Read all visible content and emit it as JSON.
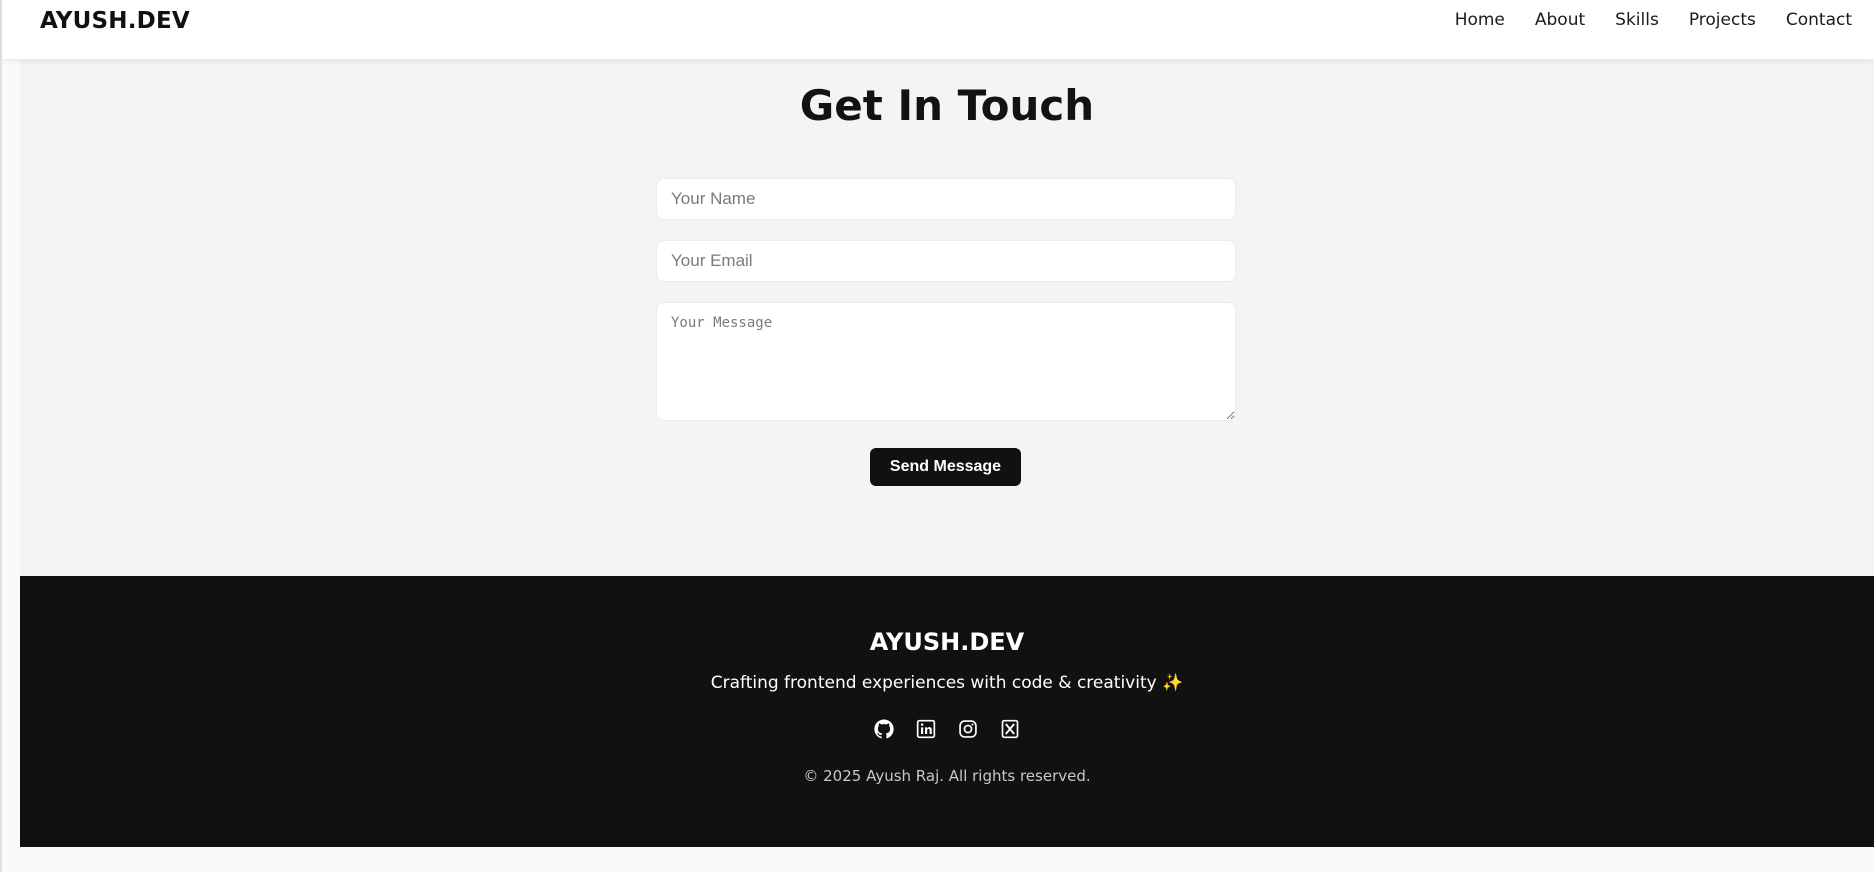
{
  "navbar": {
    "brand": "AYUSH.DEV",
    "links": [
      {
        "label": "Home"
      },
      {
        "label": "About"
      },
      {
        "label": "Skills"
      },
      {
        "label": "Projects"
      },
      {
        "label": "Contact"
      }
    ]
  },
  "contact": {
    "title": "Get In Touch",
    "name_placeholder": "Your Name",
    "email_placeholder": "Your Email",
    "message_placeholder": "Your Message",
    "send_label": "Send Message"
  },
  "footer": {
    "brand": "AYUSH.DEV",
    "tagline": "Crafting frontend experiences with code & creativity",
    "tagline_emoji": "✨",
    "social_icons": [
      "github-icon",
      "linkedin-icon",
      "instagram-icon",
      "x-icon"
    ],
    "copyright": "© 2025 Ayush Raj. All rights reserved."
  },
  "colors": {
    "page_bg": "#f4f4f4",
    "header_bg": "#ffffff",
    "footer_bg": "#111111",
    "button_bg": "#111111",
    "text_dark": "#121212"
  }
}
